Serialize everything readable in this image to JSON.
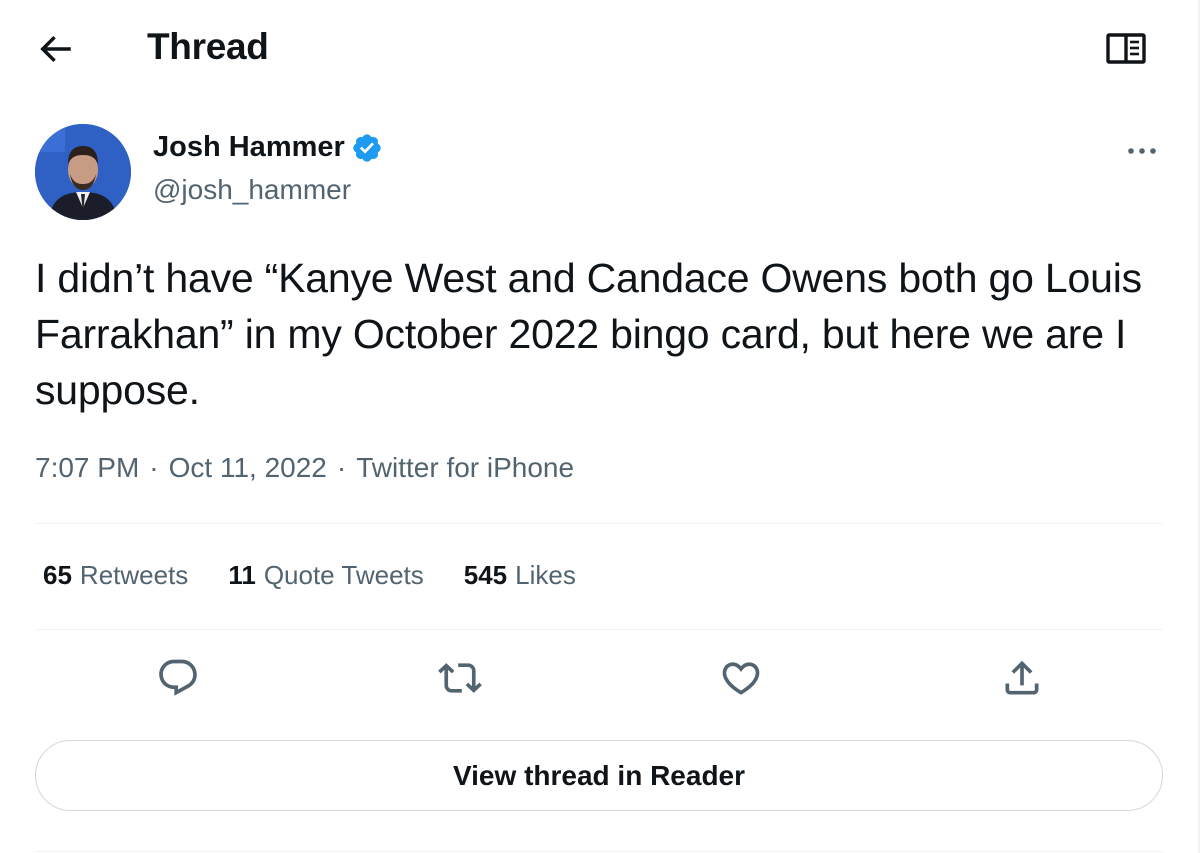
{
  "header": {
    "title": "Thread",
    "back_icon": "arrow-left-icon",
    "reader_icon": "reader-mode-icon"
  },
  "author": {
    "name": "Josh Hammer",
    "handle": "@josh_hammer",
    "verified": true,
    "avatar_icon": "avatar"
  },
  "tweet": {
    "text": "I didn’t have “Kanye West and Candace Owens both go Louis Farrakhan” in my October 2022 bingo card, but here we are I suppose.",
    "time": "7:07 PM",
    "date": "Oct 11, 2022",
    "source": "Twitter for iPhone",
    "separator": "·"
  },
  "stats": {
    "retweets_count": "65",
    "retweets_label": "Retweets",
    "quotes_count": "11",
    "quotes_label": "Quote Tweets",
    "likes_count": "545",
    "likes_label": "Likes"
  },
  "actions": {
    "reply_icon": "reply-icon",
    "retweet_icon": "retweet-icon",
    "like_icon": "heart-icon",
    "share_icon": "share-icon"
  },
  "reader_button_label": "View thread in Reader",
  "colors": {
    "text_primary": "#0f1419",
    "text_secondary": "#536471",
    "verified_blue": "#1d9bf0",
    "divider": "#eff3f4",
    "button_border": "#cfd9de"
  }
}
